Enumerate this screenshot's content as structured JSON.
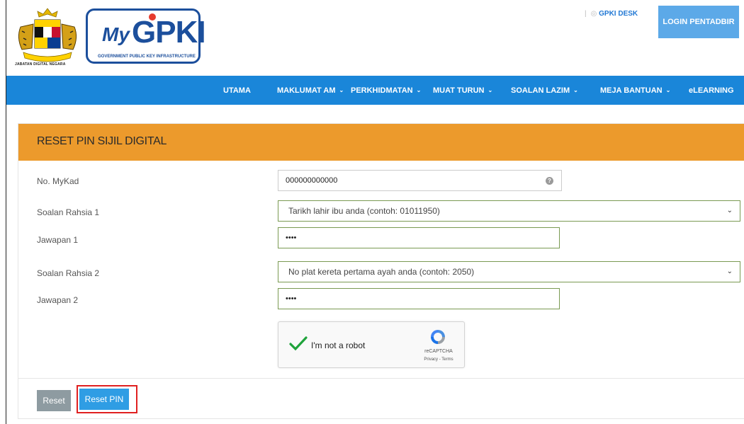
{
  "header": {
    "crest_caption": "JABATAN DIGITAL NEGARA",
    "logo_my": "My",
    "logo_gpki": "GPKI",
    "logo_tag": "GOVERNMENT PUBLIC KEY INFRASTRUCTURE",
    "gpki_desk": "GPKI DESK",
    "login_label": "LOGIN PENTADBIR"
  },
  "nav": {
    "utama": "UTAMA",
    "maklumat_am": "MAKLUMAT AM",
    "perkhidmatan": "PERKHIDMATAN",
    "muat_turun": "MUAT TURUN",
    "soalan_lazim": "SOALAN LAZIM",
    "meja_bantuan": "MEJA BANTUAN",
    "elearning": "eLEARNING"
  },
  "form": {
    "title": "RESET PIN SIJIL DIGITAL",
    "mykad_label": "No. MyKad",
    "mykad_value": "000000000000",
    "soalan1_label": "Soalan Rahsia 1",
    "soalan1_value": "Tarikh lahir ibu anda (contoh: 01011950)",
    "jawapan1_label": "Jawapan 1",
    "jawapan1_value": "••••",
    "soalan2_label": "Soalan Rahsia 2",
    "soalan2_value": "No plat kereta pertama ayah anda (contoh: 2050)",
    "jawapan2_label": "Jawapan 2",
    "jawapan2_value": "••••"
  },
  "captcha": {
    "label": "I'm not a robot",
    "brand": "reCAPTCHA",
    "terms": "Privacy - Terms"
  },
  "buttons": {
    "reset": "Reset",
    "reset_pin": "Reset PIN"
  },
  "colors": {
    "navbar": "#1a86d9",
    "panel_header": "#ec9a2c",
    "login": "#5ca9e8",
    "reset_pin": "#2f9de4",
    "highlight": "#e02020"
  }
}
